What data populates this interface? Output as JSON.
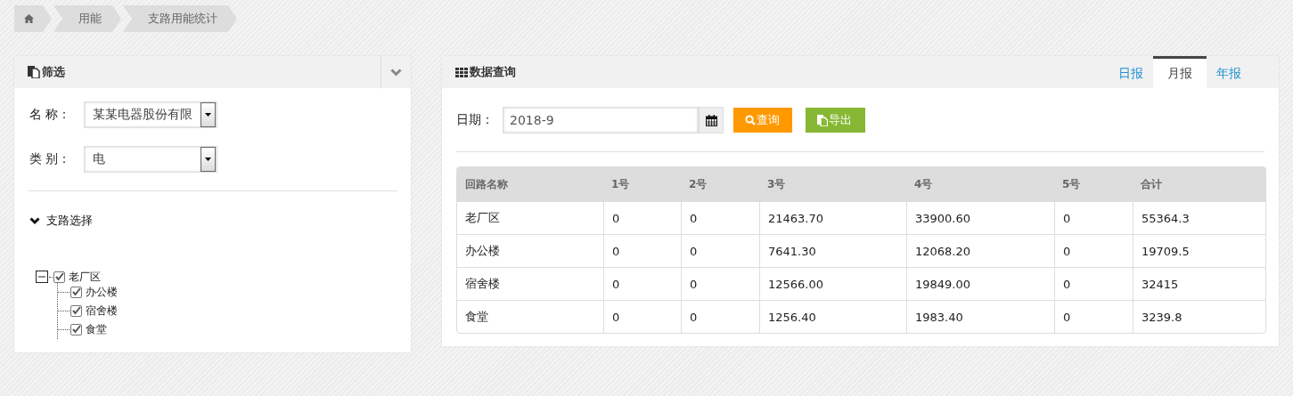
{
  "breadcrumb": [
    {
      "kind": "home"
    },
    {
      "label": "用能"
    },
    {
      "label": "支路用能统计"
    }
  ],
  "filter_panel": {
    "title": "筛选",
    "fields": [
      {
        "label": "名 称：",
        "value": "某某电器股份有限"
      },
      {
        "label": "类 别：",
        "value": "电"
      }
    ],
    "branch_section": {
      "title": "支路选择",
      "expanded": true
    },
    "tree": [
      {
        "label": "老厂区",
        "checked": true,
        "expanded": true,
        "children": [
          {
            "label": "办公楼",
            "checked": true
          },
          {
            "label": "宿舍楼",
            "checked": true
          },
          {
            "label": "食堂",
            "checked": true
          }
        ]
      }
    ]
  },
  "query_panel": {
    "title": "数据查询",
    "tabs": [
      {
        "label": "日报",
        "selected": false
      },
      {
        "label": "月报",
        "selected": true
      },
      {
        "label": "年报",
        "selected": false
      }
    ],
    "date_label": "日期：",
    "date_value": "2018-9",
    "buttons": [
      {
        "kind": "query",
        "label": "查询"
      },
      {
        "kind": "export",
        "label": "导出"
      }
    ],
    "table": {
      "columns": [
        "回路名称",
        "1号",
        "2号",
        "3号",
        "4号",
        "5号",
        "合计"
      ],
      "rows": [
        [
          "老厂区",
          "0",
          "0",
          "21463.70",
          "33900.60",
          "0",
          "55364.3"
        ],
        [
          "办公楼",
          "0",
          "0",
          "7641.30",
          "12068.20",
          "0",
          "19709.5"
        ],
        [
          "宿舍楼",
          "0",
          "0",
          "12566.00",
          "19849.00",
          "0",
          "32415"
        ],
        [
          "食堂",
          "0",
          "0",
          "1256.40",
          "1983.40",
          "0",
          "3239.8"
        ]
      ]
    }
  }
}
